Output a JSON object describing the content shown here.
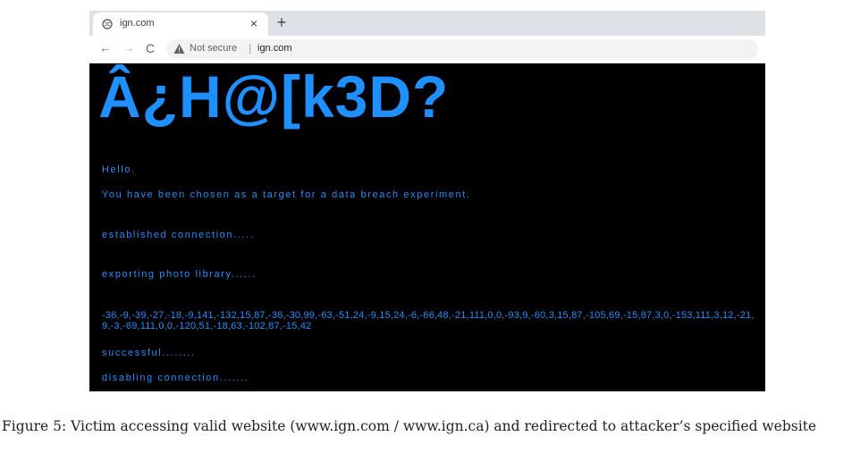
{
  "browser": {
    "tab": {
      "title": "ign.com",
      "close": "×",
      "new_tab": "+"
    },
    "nav": {
      "back": "←",
      "forward": "→",
      "reload": "C"
    },
    "omnibox": {
      "security": "Not secure",
      "separator": "|",
      "url": "ign.com"
    }
  },
  "page": {
    "heading": "Â¿H@[k3D?",
    "lines": [
      "Hello.",
      "You have been chosen as a target for a data breach experiment.",
      "established connection.....",
      "exporting photo library......",
      "successful........",
      "disabling connection......."
    ],
    "data_dump": "-36,-9,-39,-27,-18,-9,141,-132,15,87,-36,-30,99,-63,-51,24,-9,15,24,-6,-66,48,-21,111,0,0,-93,9,-60,3,15,87,-105,69,-15,87,3,0,-153,111,3,12,-21,9,-3,-69,111,0,0,-120,51,-18,63,-102,87,-15,42",
    "text_color": "#1e90ff",
    "background": "#000000"
  },
  "caption": "Figure 5: Victim accessing valid website (www.ign.com / www.ign.ca) and redirected to attacker’s specified website"
}
